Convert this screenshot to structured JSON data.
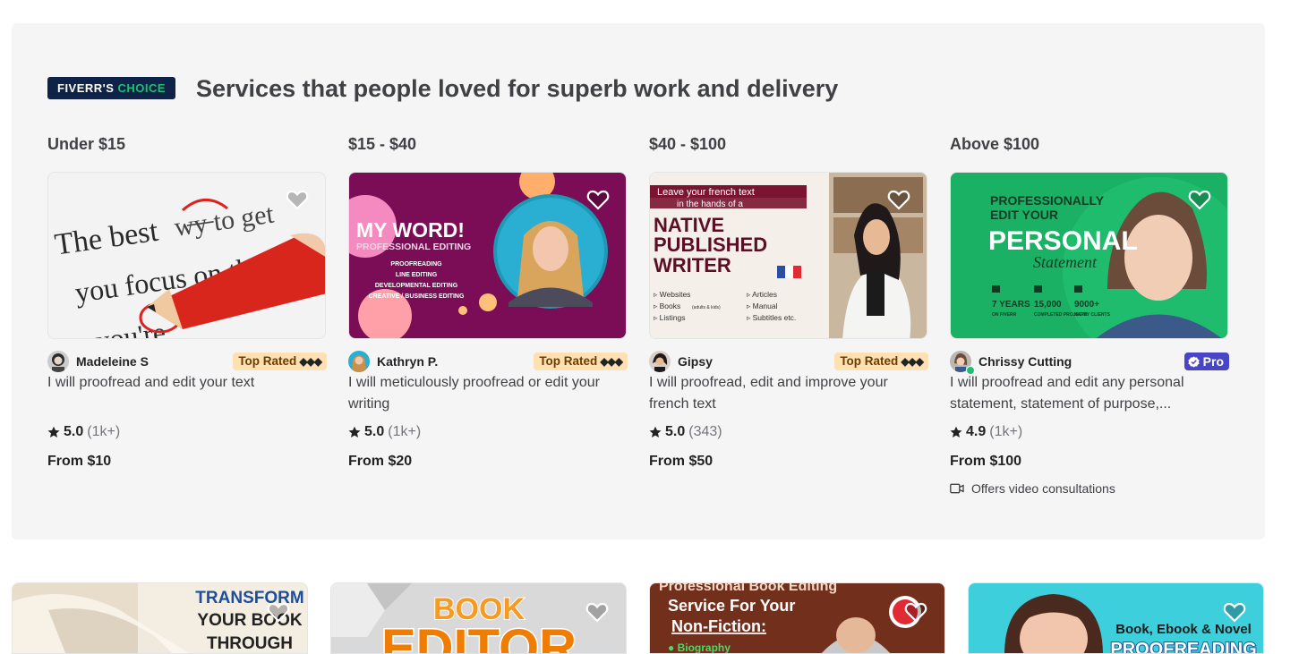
{
  "section": {
    "badge_brand": "FIVERR'S",
    "badge_accent": "CHOICE",
    "headline": "Services that people loved for superb work and delivery"
  },
  "columns": [
    {
      "price_range": "Under $15",
      "seller": "Madeleine S",
      "level": "Top Rated",
      "level_marks": "◆◆◆",
      "title": "I will proofread and edit your text",
      "rating": "5.0",
      "reviews": "(1k+)",
      "price": "From $10",
      "thumb_text": [
        "The best",
        "w̶y̶ to get",
        "you focus on th",
        "you're"
      ]
    },
    {
      "price_range": "$15 - $40",
      "seller": "Kathryn P.",
      "level": "Top Rated",
      "level_marks": "◆◆◆",
      "title": "I will meticulously proofread or edit your writing",
      "rating": "5.0",
      "reviews": "(1k+)",
      "price": "From $20",
      "thumb_text": [
        "MY WORD!",
        "PROFESSIONAL EDITING",
        "PROOFREADING",
        "LINE EDITING",
        "DEVELOPMENTAL EDITING",
        "CREATIVE / BUSINESS EDITING"
      ]
    },
    {
      "price_range": "$40 - $100",
      "seller": "Gipsy",
      "level": "Top Rated",
      "level_marks": "◆◆◆",
      "title": "I will proofread, edit and improve your french text",
      "rating": "5.0",
      "reviews": "(343)",
      "price": "From $50",
      "thumb_text": [
        "Leave your french text",
        "in the hands of a",
        "NATIVE",
        "PUBLISHED",
        "WRITER",
        "▹ Websites",
        "▹ Books",
        "(adults & kids)",
        "▹ Listings",
        "▹ Articles",
        "▹ Manual",
        "▹ Subtitles etc."
      ]
    },
    {
      "price_range": "Above $100",
      "seller": "Chrissy Cutting",
      "pro_label": "Pro",
      "title": "I will proofread and edit any personal statement, statement of purpose,...",
      "rating": "4.9",
      "reviews": "(1k+)",
      "price": "From $100",
      "video_label": "Offers video consultations",
      "thumb_text": [
        "PROFESSIONALLY",
        "EDIT YOUR",
        "PERSONAL",
        "Statement",
        "7 YEARS",
        "ON FIVERR",
        "15,000",
        "COMPLETED PROJECTS",
        "9000+",
        "HAPPY CLIENTS"
      ]
    }
  ],
  "more_gigs": [
    {
      "thumb_text": [
        "TRANSFORM",
        "YOUR BOOK",
        "THROUGH"
      ]
    },
    {
      "thumb_text": [
        "BOOK",
        "EDITOR"
      ]
    },
    {
      "thumb_text": [
        "Professional Book Editing",
        "Service For Your",
        "Non-Fiction:",
        "● Biography"
      ]
    },
    {
      "thumb_text": [
        "Book, Ebook & Novel",
        "PROOFREADING"
      ]
    }
  ],
  "colors": {
    "panel_bg": "#f5f5f5",
    "badge_bg": "#0e2347",
    "accent_green": "#1dbf73",
    "top_rated_bg": "#ffe0b3",
    "pro_bg": "#4a45c7"
  }
}
